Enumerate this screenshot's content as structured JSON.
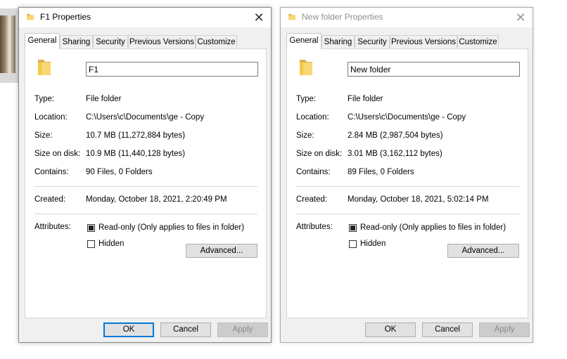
{
  "dialogs": [
    {
      "title": "F1 Properties",
      "tabs": [
        "General",
        "Sharing",
        "Security",
        "Previous Versions",
        "Customize"
      ],
      "name_value": "F1",
      "type_label": "Type:",
      "type_value": "File folder",
      "location_label": "Location:",
      "location_value": "C:\\Users\\c\\Documents\\ge - Copy",
      "size_label": "Size:",
      "size_value": "10.7 MB (11,272,884 bytes)",
      "size_on_disk_label": "Size on disk:",
      "size_on_disk_value": "10.9 MB (11,440,128 bytes)",
      "contains_label": "Contains:",
      "contains_value": "90 Files, 0 Folders",
      "created_label": "Created:",
      "created_value": "Monday, October 18, 2021, 2:20:49 PM",
      "attributes_label": "Attributes:",
      "readonly_label": "Read-only (Only applies to files in folder)",
      "hidden_label": "Hidden",
      "advanced_label": "Advanced...",
      "ok_label": "OK",
      "cancel_label": "Cancel",
      "apply_label": "Apply"
    },
    {
      "title": "New folder Properties",
      "tabs": [
        "General",
        "Sharing",
        "Security",
        "Previous Versions",
        "Customize"
      ],
      "name_value": "New folder",
      "type_label": "Type:",
      "type_value": "File folder",
      "location_label": "Location:",
      "location_value": "C:\\Users\\c\\Documents\\ge - Copy",
      "size_label": "Size:",
      "size_value": "2.84 MB (2,987,504 bytes)",
      "size_on_disk_label": "Size on disk:",
      "size_on_disk_value": "3.01 MB (3,162,112 bytes)",
      "contains_label": "Contains:",
      "contains_value": "89 Files, 0 Folders",
      "created_label": "Created:",
      "created_value": "Monday, October 18, 2021, 5:02:14 PM",
      "attributes_label": "Attributes:",
      "readonly_label": "Read-only (Only applies to files in folder)",
      "hidden_label": "Hidden",
      "advanced_label": "Advanced...",
      "ok_label": "OK",
      "cancel_label": "Cancel",
      "apply_label": "Apply"
    }
  ],
  "icons": {
    "folder": "folder-icon",
    "close": "close-icon",
    "checkbox": "checkbox-icon"
  },
  "colors": {
    "folder": "#f8d775",
    "focus": "#0078d7",
    "dialog_bg": "#f0f0f0"
  }
}
